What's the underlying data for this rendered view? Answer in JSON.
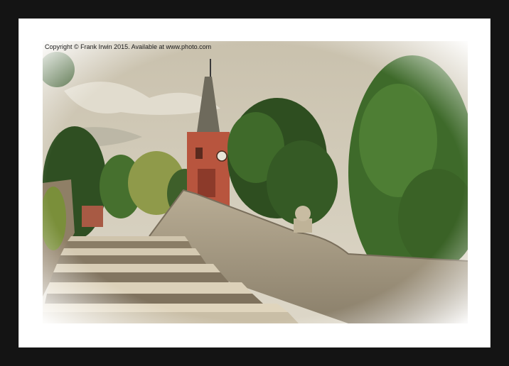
{
  "photo": {
    "copyright_text": "Copyright © Frank Irwin 2015. Available at www.photo.com",
    "subject": "church-spire-and-stone-bridge-steps"
  },
  "colors": {
    "frame": "#141414",
    "mount": "#ffffff",
    "sky": "#cfc7b2",
    "brick": "#b8553e",
    "foliage": "#3e6a2a",
    "stone": "#b8ac92"
  }
}
